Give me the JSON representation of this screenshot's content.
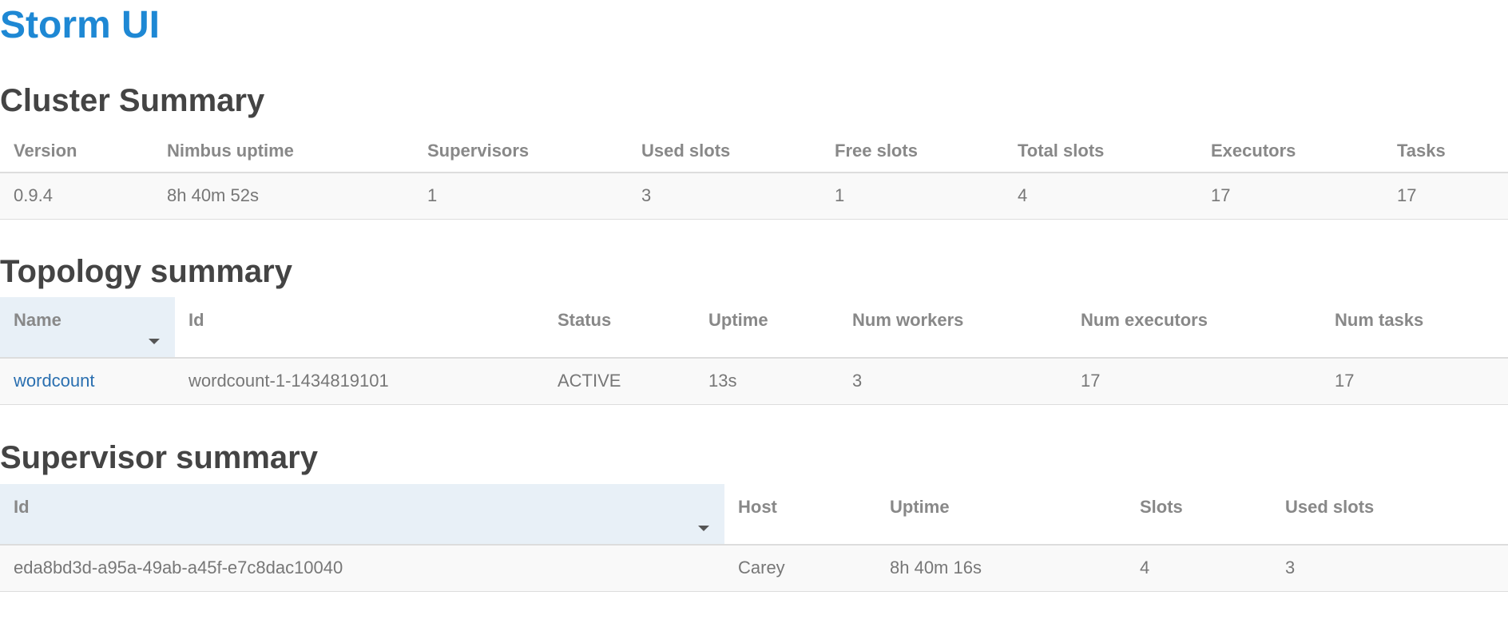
{
  "app": {
    "title": "Storm UI"
  },
  "cluster": {
    "title": "Cluster Summary",
    "columns": [
      "Version",
      "Nimbus uptime",
      "Supervisors",
      "Used slots",
      "Free slots",
      "Total slots",
      "Executors",
      "Tasks"
    ],
    "row": [
      "0.9.4",
      "8h 40m 52s",
      "1",
      "3",
      "1",
      "4",
      "17",
      "17"
    ]
  },
  "topology": {
    "title": "Topology summary",
    "columns": [
      "Name",
      "Id",
      "Status",
      "Uptime",
      "Num workers",
      "Num executors",
      "Num tasks"
    ],
    "row": [
      "wordcount",
      "wordcount-1-1434819101",
      "ACTIVE",
      "13s",
      "3",
      "17",
      "17"
    ]
  },
  "supervisor": {
    "title": "Supervisor summary",
    "columns": [
      "Id",
      "Host",
      "Uptime",
      "Slots",
      "Used slots"
    ],
    "row": [
      "eda8bd3d-a95a-49ab-a45f-e7c8dac10040",
      "Carey",
      "8h 40m 16s",
      "4",
      "3"
    ]
  },
  "colors": {
    "title_blue": "#1e88d4",
    "link_blue": "#2a6fb0",
    "sorted_header_bg": "#e8f0f7"
  },
  "icons": {
    "sort": "caret-down-icon"
  }
}
